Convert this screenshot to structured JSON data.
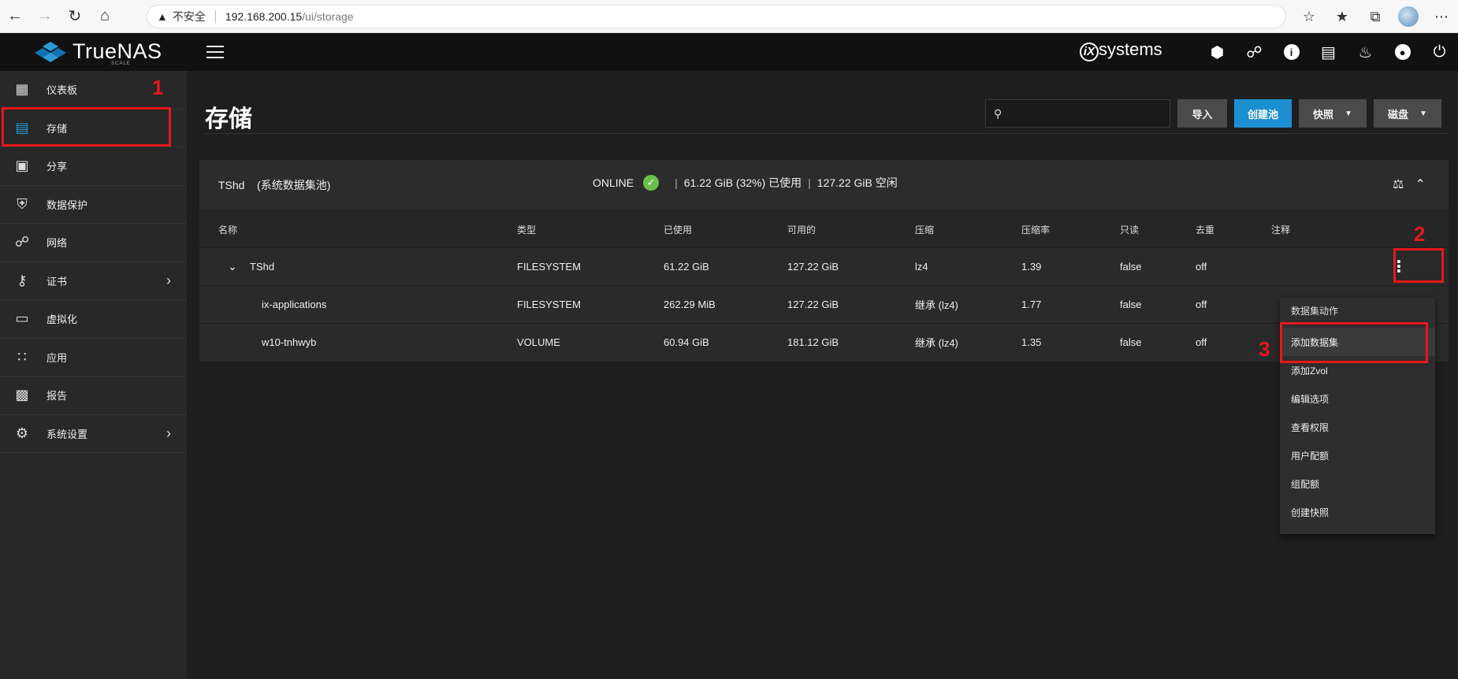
{
  "browser": {
    "warning": "不安全",
    "url_host": "192.168.200.15",
    "url_path": "/ui/storage"
  },
  "brand": {
    "logo_text": "TrueNAS",
    "logo_sub": "SCALE",
    "vendor": "systems",
    "vendor_mark": "iX"
  },
  "sidebar": {
    "items": [
      {
        "label": "仪表板",
        "icon": "dashboard-icon",
        "active": false,
        "chevron": false
      },
      {
        "label": "存储",
        "icon": "storage-icon",
        "active": true,
        "chevron": false
      },
      {
        "label": "分享",
        "icon": "share-folder-icon",
        "active": false,
        "chevron": false
      },
      {
        "label": "数据保护",
        "icon": "shield-icon",
        "active": false,
        "chevron": false
      },
      {
        "label": "网络",
        "icon": "network-icon",
        "active": false,
        "chevron": false
      },
      {
        "label": "证书",
        "icon": "key-icon",
        "active": false,
        "chevron": true
      },
      {
        "label": "虚拟化",
        "icon": "laptop-icon",
        "active": false,
        "chevron": false
      },
      {
        "label": "应用",
        "icon": "apps-grid-icon",
        "active": false,
        "chevron": false
      },
      {
        "label": "报告",
        "icon": "bar-chart-icon",
        "active": false,
        "chevron": false
      },
      {
        "label": "系统设置",
        "icon": "gear-icon",
        "active": false,
        "chevron": true
      }
    ]
  },
  "annotations": {
    "one": "1",
    "two": "2",
    "three": "3"
  },
  "page": {
    "title": "存储",
    "buttons": {
      "import": "导入",
      "create_pool": "创建池",
      "snapshot": "快照",
      "disks": "磁盘"
    }
  },
  "pool": {
    "name": "TShd",
    "system_tag": "(系统数据集池)",
    "status": "ONLINE",
    "used": "61.22 GiB (32%) 已使用",
    "free": "127.22 GiB 空闲"
  },
  "table": {
    "headers": [
      "名称",
      "类型",
      "已使用",
      "可用的",
      "压缩",
      "压缩率",
      "只读",
      "去重",
      "注释"
    ],
    "rows": [
      {
        "name": "TShd",
        "type": "FILESYSTEM",
        "used": "61.22 GiB",
        "avail": "127.22 GiB",
        "comp": "lz4",
        "ratio": "1.39",
        "ro": "false",
        "dedup": "off"
      },
      {
        "name": "ix-applications",
        "type": "FILESYSTEM",
        "used": "262.29 MiB",
        "avail": "127.22 GiB",
        "comp": "继承 (lz4)",
        "ratio": "1.77",
        "ro": "false",
        "dedup": "off"
      },
      {
        "name": "w10-tnhwyb",
        "type": "VOLUME",
        "used": "60.94 GiB",
        "avail": "181.12 GiB",
        "comp": "继承 (lz4)",
        "ratio": "1.35",
        "ro": "false",
        "dedup": "off"
      }
    ]
  },
  "menu": {
    "header": "数据集动作",
    "items": [
      "添加数据集",
      "添加Zvol",
      "编辑选项",
      "查看权限",
      "用户配额",
      "组配额",
      "创建快照"
    ]
  }
}
